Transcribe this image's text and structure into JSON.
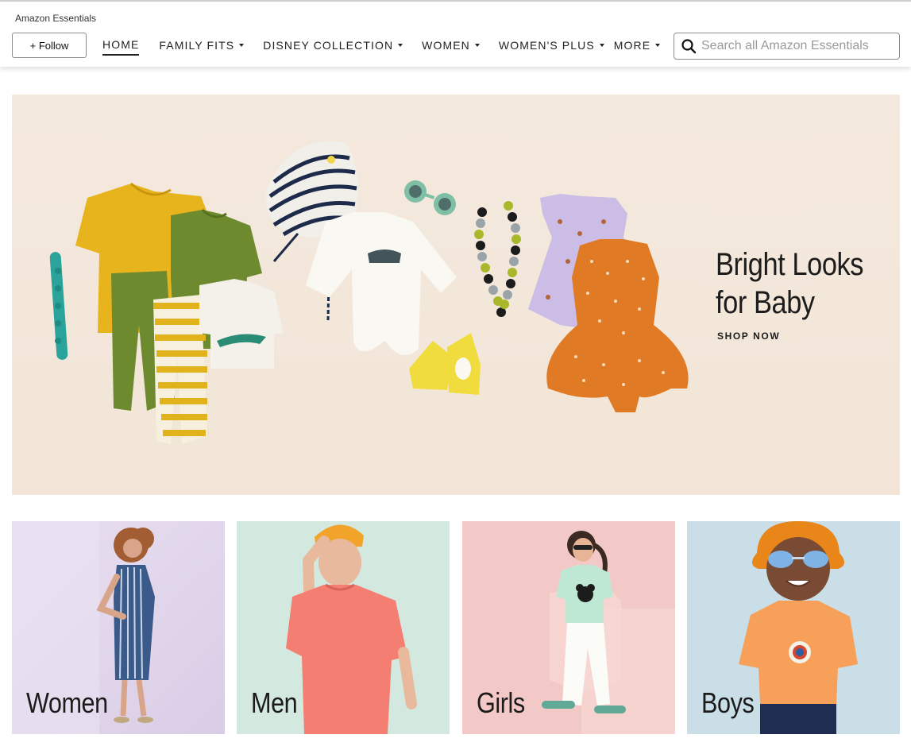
{
  "header": {
    "brand": "Amazon Essentials",
    "follow_label": "+ Follow",
    "nav": [
      {
        "label": "HOME",
        "dropdown": false,
        "active": true
      },
      {
        "label": "FAMILY FITS",
        "dropdown": true
      },
      {
        "label": "DISNEY COLLECTION",
        "dropdown": true
      },
      {
        "label": "WOMEN",
        "dropdown": true
      },
      {
        "label": "WOMEN'S PLUS",
        "dropdown": true
      },
      {
        "label": "MORE",
        "dropdown": true
      }
    ],
    "search": {
      "placeholder": "Search all Amazon Essentials",
      "icon": "search-icon"
    }
  },
  "hero": {
    "title": "Bright Looks\nfor Baby",
    "cta": "SHOP NOW"
  },
  "tiles": [
    {
      "label": "Women"
    },
    {
      "label": "Men"
    },
    {
      "label": "Girls"
    },
    {
      "label": "Boys"
    }
  ]
}
